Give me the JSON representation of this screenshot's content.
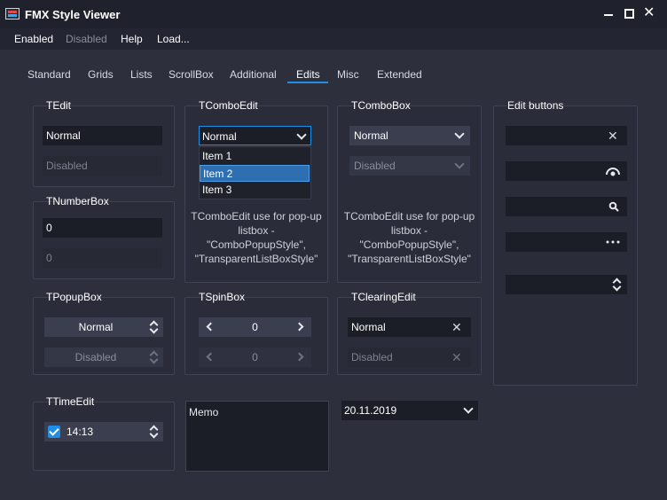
{
  "window": {
    "title": "FMX Style Viewer"
  },
  "menu": [
    {
      "label": "Enabled",
      "disabled": false
    },
    {
      "label": "Disabled",
      "disabled": true
    },
    {
      "label": "Help",
      "disabled": false
    },
    {
      "label": "Load...",
      "disabled": false
    }
  ],
  "tabs": [
    "Standard",
    "Grids",
    "Lists",
    "ScrollBox",
    "Additional",
    "Edits",
    "Misc",
    "Extended"
  ],
  "active_tab": "Edits",
  "tedit": {
    "title": "TEdit",
    "normal": "Normal",
    "disabled": "Disabled"
  },
  "tnumberbox": {
    "title": "TNumberBox",
    "normal": "0",
    "disabled": "0"
  },
  "tpopupbox": {
    "title": "TPopupBox",
    "normal": "Normal",
    "disabled": "Disabled"
  },
  "ttimeedit": {
    "title": "TTimeEdit",
    "value": "14:13",
    "checked": true
  },
  "tcomboedit": {
    "title": "TComboEdit",
    "value": "Normal",
    "items": [
      "Item 1",
      "Item 2",
      "Item 3"
    ],
    "selected_index": 1,
    "desc": [
      "TComboEdit use for pop-up",
      "listbox -",
      "\"ComboPopupStyle\",",
      "\"TransparentListBoxStyle\""
    ]
  },
  "tspinbox": {
    "title": "TSpinBox",
    "normal": "0",
    "disabled": "0"
  },
  "memo": {
    "text": "Memo"
  },
  "tcombobox": {
    "title": "TComboBox",
    "normal": "Normal",
    "disabled": "Disabled",
    "desc": [
      "TComboEdit use for pop-up",
      "listbox -",
      "\"ComboPopupStyle\",",
      "\"TransparentListBoxStyle\""
    ]
  },
  "tclearingedit": {
    "title": "TClearingEdit",
    "normal": "Normal",
    "disabled": "Disabled"
  },
  "dateedit": {
    "value": "20.11.2019"
  },
  "edit_buttons": {
    "title": "Edit buttons"
  },
  "colors": {
    "accent": "#1f8ee6",
    "background": "#2d2f3d",
    "titlebar": "#1f212c"
  }
}
